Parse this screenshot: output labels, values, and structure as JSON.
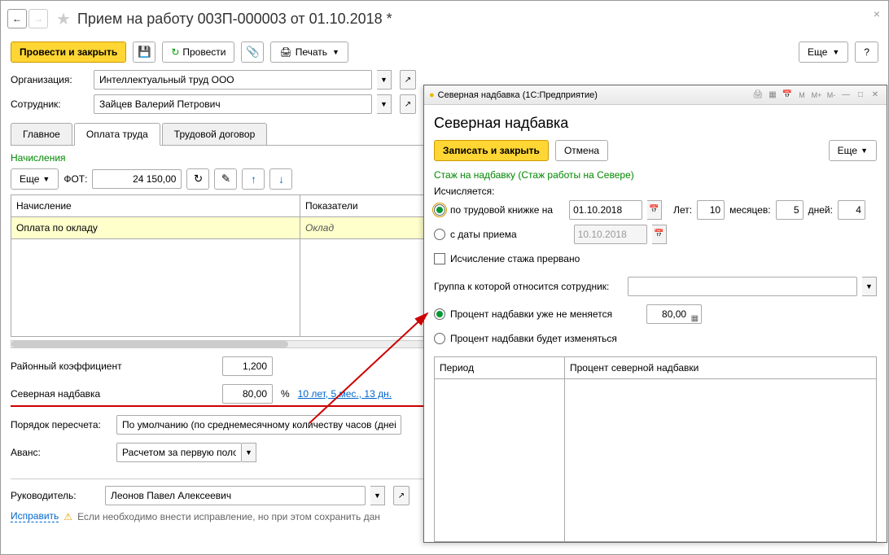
{
  "window": {
    "title": "Прием на работу 003П-000003 от 01.10.2018 *"
  },
  "toolbar": {
    "submit_close": "Провести и закрыть",
    "submit": "Провести",
    "print": "Печать",
    "more": "Еще",
    "help": "?"
  },
  "form": {
    "org_label": "Организация:",
    "org_value": "Интеллектуальный труд ООО",
    "emp_label": "Сотрудник:",
    "emp_value": "Зайцев Валерий Петрович"
  },
  "tabs": {
    "main": "Главное",
    "pay": "Оплата труда",
    "contract": "Трудовой договор"
  },
  "accruals": {
    "heading": "Начисления",
    "more": "Еще",
    "fot_label": "ФОТ:",
    "fot_value": "24 150,00",
    "col_accrual": "Начисление",
    "col_indicators": "Показатели",
    "row_accrual": "Оплата по окладу",
    "row_indicator": "Оклад"
  },
  "fields": {
    "regional_label": "Районный коэффициент",
    "regional_value": "1,200",
    "north_label": "Северная надбавка",
    "north_value": "80,00",
    "north_unit": "%",
    "north_link": "10 лет, 5 мес., 13 дн.",
    "recalc_label": "Порядок пересчета:",
    "recalc_value": "По умолчанию (по среднемесячному количеству часов (дней))",
    "advance_label": "Аванс:",
    "advance_value": "Расчетом за первую половину"
  },
  "footer": {
    "manager_label": "Руководитель:",
    "manager_value": "Леонов Павел Алексеевич",
    "fix_link": "Исправить",
    "fix_text": "Если необходимо внести исправление, но при этом сохранить дан"
  },
  "popup": {
    "app_title": "Северная надбавка  (1С:Предприятие)",
    "title": "Северная надбавка",
    "save_close": "Записать и закрыть",
    "cancel": "Отмена",
    "more": "Еще",
    "seniority_link": "Стаж на надбавку (Стаж работы на Севере)",
    "calc_label": "Исчисляется:",
    "by_workbook": "по трудовой книжке на",
    "workbook_date": "01.10.2018",
    "years_label": "Лет:",
    "years_value": "10",
    "months_label": "месяцев:",
    "months_value": "5",
    "days_label": "дней:",
    "days_value": "4",
    "from_hire": "с даты приема",
    "hire_date": "10.10.2018",
    "interrupted": "Исчисление стажа прервано",
    "group_label": "Группа к которой относится сотрудник:",
    "pct_fixed": "Процент надбавки уже не меняется",
    "pct_value": "80,00",
    "pct_changes": "Процент надбавки будет изменяться",
    "col_period": "Период",
    "col_pct": "Процент северной надбавки"
  }
}
